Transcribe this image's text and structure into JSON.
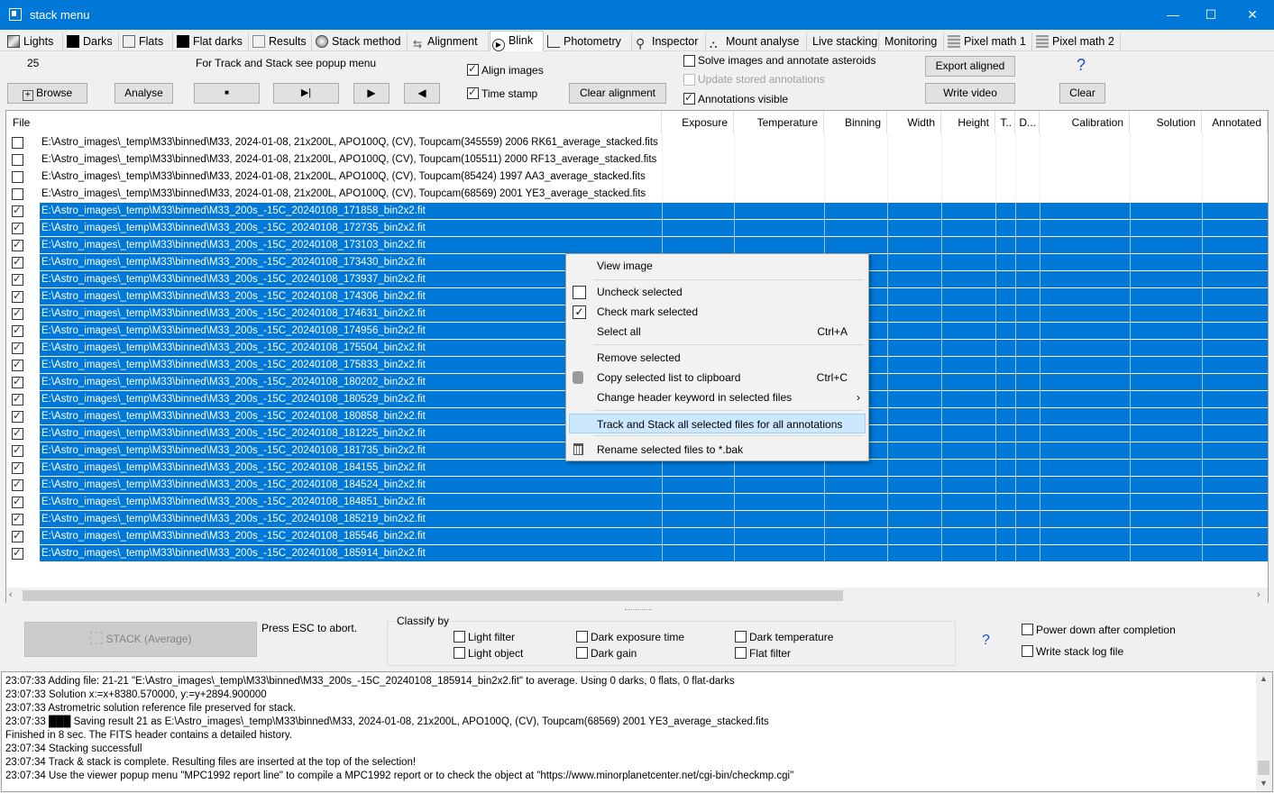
{
  "window": {
    "title": "stack menu",
    "minimize": "—",
    "maximize": "☐",
    "close": "✕"
  },
  "tabs": [
    {
      "label": "Lights",
      "icon": "lights-icon"
    },
    {
      "label": "Darks",
      "icon": "darks-icon"
    },
    {
      "label": "Flats",
      "icon": "flats-icon"
    },
    {
      "label": "Flat darks",
      "icon": "flat-darks-icon"
    },
    {
      "label": "Results",
      "icon": "results-icon"
    },
    {
      "label": "Stack method",
      "icon": "stack-method-icon"
    },
    {
      "label": "Alignment",
      "icon": "alignment-icon"
    },
    {
      "label": "Blink",
      "icon": "blink-icon",
      "active": true
    },
    {
      "label": "Photometry",
      "icon": "photometry-icon"
    },
    {
      "label": "Inspector",
      "icon": "inspector-icon"
    },
    {
      "label": "Mount analyse",
      "icon": "mount-icon"
    },
    {
      "label": "Live stacking",
      "icon": ""
    },
    {
      "label": "Monitoring",
      "icon": ""
    },
    {
      "label": "Pixel math 1",
      "icon": "pixel-math-icon"
    },
    {
      "label": "Pixel math 2",
      "icon": "pixel-math-icon"
    }
  ],
  "toolbar": {
    "counter": "25",
    "hint": "For Track and Stack see popup menu",
    "browse": "Browse",
    "analyse": "Analyse",
    "stop_icon": "■",
    "step_icon": "▶|",
    "play_icon": "▶",
    "back_icon": "◀",
    "align_images": "Align images",
    "time_stamp": "Time stamp",
    "clear_alignment": "Clear alignment",
    "solve_images": "Solve images and annotate asteroids",
    "update_annotations": "Update stored annotations",
    "annotations_visible": "Annotations visible",
    "export_aligned": "Export aligned",
    "write_video": "Write video",
    "help": "?",
    "clear": "Clear"
  },
  "table": {
    "headers": [
      "File",
      "Exposure",
      "Temperature",
      "Binning",
      "Width",
      "Height",
      "T..",
      "D...",
      "Calibration",
      "Solution",
      "Annotated"
    ],
    "rows": [
      {
        "checked": false,
        "selected": false,
        "file": "E:\\Astro_images\\_temp\\M33\\binned\\M33, 2024-01-08, 21x200L, APO100Q, (CV), Toupcam(345559) 2006 RK61_average_stacked.fits"
      },
      {
        "checked": false,
        "selected": false,
        "file": "E:\\Astro_images\\_temp\\M33\\binned\\M33, 2024-01-08, 21x200L, APO100Q, (CV), Toupcam(105511) 2000 RF13_average_stacked.fits"
      },
      {
        "checked": false,
        "selected": false,
        "file": "E:\\Astro_images\\_temp\\M33\\binned\\M33, 2024-01-08, 21x200L, APO100Q, (CV), Toupcam(85424) 1997 AA3_average_stacked.fits"
      },
      {
        "checked": false,
        "selected": false,
        "file": "E:\\Astro_images\\_temp\\M33\\binned\\M33, 2024-01-08, 21x200L, APO100Q, (CV), Toupcam(68569) 2001 YE3_average_stacked.fits"
      },
      {
        "checked": true,
        "selected": true,
        "file": "E:\\Astro_images\\_temp\\M33\\binned\\M33_200s_-15C_20240108_171858_bin2x2.fit"
      },
      {
        "checked": true,
        "selected": true,
        "file": "E:\\Astro_images\\_temp\\M33\\binned\\M33_200s_-15C_20240108_172735_bin2x2.fit"
      },
      {
        "checked": true,
        "selected": true,
        "file": "E:\\Astro_images\\_temp\\M33\\binned\\M33_200s_-15C_20240108_173103_bin2x2.fit"
      },
      {
        "checked": true,
        "selected": true,
        "file": "E:\\Astro_images\\_temp\\M33\\binned\\M33_200s_-15C_20240108_173430_bin2x2.fit"
      },
      {
        "checked": true,
        "selected": true,
        "file": "E:\\Astro_images\\_temp\\M33\\binned\\M33_200s_-15C_20240108_173937_bin2x2.fit"
      },
      {
        "checked": true,
        "selected": true,
        "file": "E:\\Astro_images\\_temp\\M33\\binned\\M33_200s_-15C_20240108_174306_bin2x2.fit"
      },
      {
        "checked": true,
        "selected": true,
        "file": "E:\\Astro_images\\_temp\\M33\\binned\\M33_200s_-15C_20240108_174631_bin2x2.fit"
      },
      {
        "checked": true,
        "selected": true,
        "file": "E:\\Astro_images\\_temp\\M33\\binned\\M33_200s_-15C_20240108_174956_bin2x2.fit"
      },
      {
        "checked": true,
        "selected": true,
        "file": "E:\\Astro_images\\_temp\\M33\\binned\\M33_200s_-15C_20240108_175504_bin2x2.fit"
      },
      {
        "checked": true,
        "selected": true,
        "file": "E:\\Astro_images\\_temp\\M33\\binned\\M33_200s_-15C_20240108_175833_bin2x2.fit"
      },
      {
        "checked": true,
        "selected": true,
        "file": "E:\\Astro_images\\_temp\\M33\\binned\\M33_200s_-15C_20240108_180202_bin2x2.fit"
      },
      {
        "checked": true,
        "selected": true,
        "file": "E:\\Astro_images\\_temp\\M33\\binned\\M33_200s_-15C_20240108_180529_bin2x2.fit"
      },
      {
        "checked": true,
        "selected": true,
        "file": "E:\\Astro_images\\_temp\\M33\\binned\\M33_200s_-15C_20240108_180858_bin2x2.fit"
      },
      {
        "checked": true,
        "selected": true,
        "file": "E:\\Astro_images\\_temp\\M33\\binned\\M33_200s_-15C_20240108_181225_bin2x2.fit"
      },
      {
        "checked": true,
        "selected": true,
        "file": "E:\\Astro_images\\_temp\\M33\\binned\\M33_200s_-15C_20240108_181735_bin2x2.fit"
      },
      {
        "checked": true,
        "selected": true,
        "file": "E:\\Astro_images\\_temp\\M33\\binned\\M33_200s_-15C_20240108_184155_bin2x2.fit"
      },
      {
        "checked": true,
        "selected": true,
        "file": "E:\\Astro_images\\_temp\\M33\\binned\\M33_200s_-15C_20240108_184524_bin2x2.fit"
      },
      {
        "checked": true,
        "selected": true,
        "file": "E:\\Astro_images\\_temp\\M33\\binned\\M33_200s_-15C_20240108_184851_bin2x2.fit"
      },
      {
        "checked": true,
        "selected": true,
        "file": "E:\\Astro_images\\_temp\\M33\\binned\\M33_200s_-15C_20240108_185219_bin2x2.fit"
      },
      {
        "checked": true,
        "selected": true,
        "file": "E:\\Astro_images\\_temp\\M33\\binned\\M33_200s_-15C_20240108_185546_bin2x2.fit"
      },
      {
        "checked": true,
        "selected": true,
        "file": "E:\\Astro_images\\_temp\\M33\\binned\\M33_200s_-15C_20240108_185914_bin2x2.fit"
      }
    ]
  },
  "context_menu": {
    "items": [
      {
        "label": "View image",
        "shortcut": "",
        "icon": ""
      },
      {
        "label": "Uncheck selected",
        "shortcut": "",
        "icon": "unchecked-box-icon"
      },
      {
        "label": "Check mark selected",
        "shortcut": "",
        "icon": "checked-box-icon"
      },
      {
        "label": "Select all",
        "shortcut": "Ctrl+A",
        "icon": ""
      },
      {
        "label": "Remove selected",
        "shortcut": "",
        "icon": ""
      },
      {
        "label": "Copy selected list to clipboard",
        "shortcut": "Ctrl+C",
        "icon": "clipboard-icon"
      },
      {
        "label": "Change header keyword in selected files",
        "shortcut": "›",
        "icon": ""
      },
      {
        "label": "Track and Stack all selected files for all annotations",
        "shortcut": "",
        "icon": "",
        "highlighted": true
      },
      {
        "label": "Rename selected files to *.bak",
        "shortcut": "",
        "icon": "trash-icon"
      }
    ]
  },
  "bottom": {
    "stack_button": "STACK (Average)",
    "esc_hint": "Press ESC to abort.",
    "classify_title": "Classify by",
    "light_filter": "Light filter",
    "light_object": "Light object",
    "dark_exposure": "Dark exposure time",
    "dark_gain": "Dark gain",
    "dark_temperature": "Dark temperature",
    "flat_filter": "Flat filter",
    "help": "?",
    "power_down": "Power down after completion",
    "write_log": "Write stack log file"
  },
  "log": [
    "23:07:33  Adding file: 21-21 \"E:\\Astro_images\\_temp\\M33\\binned\\M33_200s_-15C_20240108_185914_bin2x2.fit\"  to average. Using 0 darks, 0 flats, 0 flat-darks",
    "23:07:33  Solution x:=x+8380.570000,  y:=y+2894.900000",
    "23:07:33  Astrometric solution reference file preserved for stack.",
    "23:07:33  ███ Saving result 21 as E:\\Astro_images\\_temp\\M33\\binned\\M33, 2024-01-08, 21x200L, APO100Q, (CV), Toupcam(68569) 2001 YE3_average_stacked.fits",
    "Finished in 8 sec. The FITS header contains a detailed history.",
    "23:07:34  Stacking successfull",
    "23:07:34  Track & stack is complete. Resulting files are inserted at the top of the selection!",
    "23:07:34  Use the viewer popup menu \"MPC1992 report line\" to compile a MPC1992 report or to check the object at \"https://www.minorplanetcenter.net/cgi-bin/checkmp.cgi\""
  ],
  "colors": {
    "accent": "#0078d7",
    "selection": "#0078d7",
    "menu_highlight": "#cce8ff"
  }
}
